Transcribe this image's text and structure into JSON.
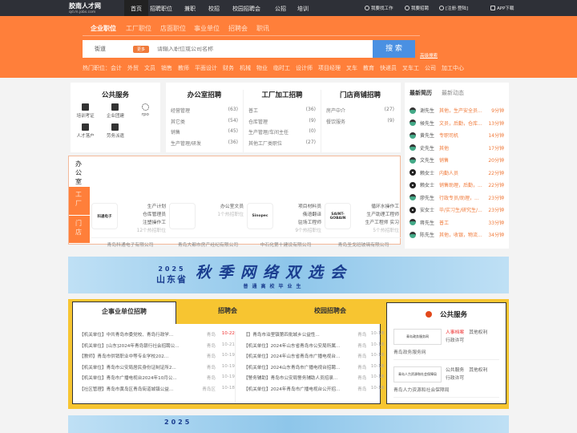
{
  "site": {
    "logo_text": "胶南人才网",
    "logo_sub": "qd.m.jobs.com"
  },
  "topnav": {
    "items": [
      "首页",
      "招聘职位",
      "兼职",
      "校招",
      "校园招聘会",
      "公招",
      "培训"
    ],
    "right": [
      "我要找工作",
      "我要招聘",
      "[注册·登陆]",
      "APP下载"
    ]
  },
  "search": {
    "tabs": [
      "企业职位",
      "工厂职位",
      "店面职位",
      "事业单位",
      "招聘会",
      "职讯"
    ],
    "area": "街道",
    "more": "更多",
    "placeholder": "请输入职位或公司名称",
    "button": "搜 索",
    "advanced": "高级搜索",
    "hot_label": "热门职位：",
    "hot": [
      "会计",
      "外贸",
      "文员",
      "销售",
      "教师",
      "平面设计",
      "财务",
      "机械",
      "物业",
      "临时工",
      "设计师",
      "项目经理",
      "叉车",
      "教育",
      "快递员",
      "叉车工",
      "公司",
      "加工中心"
    ]
  },
  "public_service": {
    "title": "公共服务",
    "items": [
      "培训考证",
      "企业团建",
      "rpo",
      "人才落户",
      "劳务派遣"
    ]
  },
  "categories": [
    {
      "title": "办公室招聘",
      "rows": [
        [
          "经营管理",
          "(63)"
        ],
        [
          "其它类",
          "(54)"
        ],
        [
          "销售",
          "(45)"
        ],
        [
          "生产管理/研发",
          "(36)"
        ]
      ]
    },
    {
      "title": "工厂加工招聘",
      "rows": [
        [
          "普工",
          "(36)"
        ],
        [
          "仓库管理",
          "(9)"
        ],
        [
          "生产管理/车间主任",
          "(0)"
        ],
        [
          "其他工厂类职位",
          "(27)"
        ]
      ]
    },
    {
      "title": "门店商铺招聘",
      "rows": [
        [
          "房产中介",
          "(27)"
        ],
        [
          "餐饮服务",
          "(9)"
        ]
      ]
    }
  ],
  "resumes": {
    "tabs": [
      "最新简历",
      "最新动态"
    ],
    "items": [
      {
        "name": "谢先生",
        "job": "其他，生产安全员...",
        "time": "9分钟",
        "g": "m"
      },
      {
        "name": "候先生",
        "job": "文员，后勤，仓库...",
        "time": "13分钟",
        "g": "m"
      },
      {
        "name": "黄先生",
        "job": "专职司机",
        "time": "14分钟",
        "g": "m"
      },
      {
        "name": "史先生",
        "job": "其他",
        "time": "17分钟",
        "g": "m"
      },
      {
        "name": "文先生",
        "job": "销售",
        "time": "20分钟",
        "g": "m"
      },
      {
        "name": "赖女士",
        "job": "内勤人员",
        "time": "22分钟",
        "g": "f"
      },
      {
        "name": "赖女士",
        "job": "销售助理，后勤，...",
        "time": "22分钟",
        "g": "f"
      },
      {
        "name": "廖先生",
        "job": "行政专员/助理，...",
        "time": "23分钟",
        "g": "m"
      },
      {
        "name": "安女士",
        "job": "毕/实习生/研究生/...",
        "time": "23分钟",
        "g": "f"
      },
      {
        "name": "蒋先生",
        "job": "普工",
        "time": "33分钟",
        "g": "m"
      },
      {
        "name": "陈先生",
        "job": "其他，收银，物流...",
        "time": "34分钟",
        "g": "m"
      }
    ]
  },
  "companies": {
    "tabs": [
      "办公室",
      "工厂",
      "门店"
    ],
    "items": [
      {
        "name": "青岛科通电子有限公司",
        "logo": "科通电子",
        "jobs": [
          "生产计划",
          "仓库管理员",
          "注塑操作工"
        ],
        "count": "12个热招职位"
      },
      {
        "name": "青岛大都市房产经纪有限公司",
        "logo": "",
        "jobs": [
          "办公室文员"
        ],
        "count": "1个热招职位"
      },
      {
        "name": "中石化第十建设有限公司",
        "logo": "Sinopec",
        "jobs": [
          "项目材料员",
          "俄语翻译",
          "驻场工程师"
        ],
        "count": "9个热招职位"
      },
      {
        "name": "青岛圣戈班玻璃有限公司",
        "logo": "SAINT-GOBAIN",
        "jobs": [
          "循环水操作工",
          "生产助理工程师",
          "生产工程师 实习"
        ],
        "count": "5个热招职位"
      }
    ]
  },
  "banner": {
    "year": "2025",
    "province": "山东省",
    "title": "秋季网络双选会",
    "sub": "普通高校毕业生"
  },
  "recruit": {
    "tabs": [
      "企事业单位招聘",
      "招聘会",
      "校园招聘会"
    ],
    "left": [
      [
        "【机关单位】中共青岛市委党校、青岛行政学...",
        "青岛",
        "10-22"
      ],
      [
        "【机关单位】[山东]2024年青岛银行社会招聘公...",
        "青岛",
        "10-21"
      ],
      [
        "【教师】青岛市供销职业中等专业学校202...",
        "青岛",
        "10-19"
      ],
      [
        "【机关单位】青岛市公安局居民身份证制证所2...",
        "青岛",
        "10-19"
      ],
      [
        "【机关单位】青岛市广播电视台2024年10月公...",
        "青岛",
        "10-19"
      ],
      [
        "【社区管理】青岛市黄岛区青岛街道城镇公益...",
        "青岛区",
        "10-18"
      ]
    ],
    "right": [
      [
        "【】青岛市泊里镇第四批城乡公益性...",
        "青岛",
        "10-18"
      ],
      [
        "【机关单位】2024年山东省青岛市公安局所属...",
        "青岛",
        "10-18"
      ],
      [
        "【机关单位】2024年山东省青岛市广播电视台...",
        "青岛",
        "10-18"
      ],
      [
        "【机关单位】2024山东青岛市广播电视台招聘...",
        "青岛",
        "10-18"
      ],
      [
        "【警务辅助】青岛市公安局警务辅助人员招录...",
        "青岛",
        "10-18"
      ],
      [
        "【机关单位】2024年青岛市广播电视台公开招...",
        "青岛",
        "10-18"
      ]
    ]
  },
  "gov": {
    "title": "公共服务",
    "items": [
      {
        "name": "青岛政务服务网",
        "logo": "青岛政务服务网",
        "links": [
          "人事档案",
          "其他权利",
          "行政许可"
        ]
      },
      {
        "name": "青岛人力资源和社会保障局",
        "logo": "青岛人力资源和社会保障局",
        "links": [
          "公共服务",
          "其他权利",
          "行政许可"
        ]
      }
    ]
  },
  "colors": {
    "orange": "#ff7f3a",
    "nav": "#2e3037",
    "blue": "#4a90e2",
    "yellow": "#f7c531"
  }
}
